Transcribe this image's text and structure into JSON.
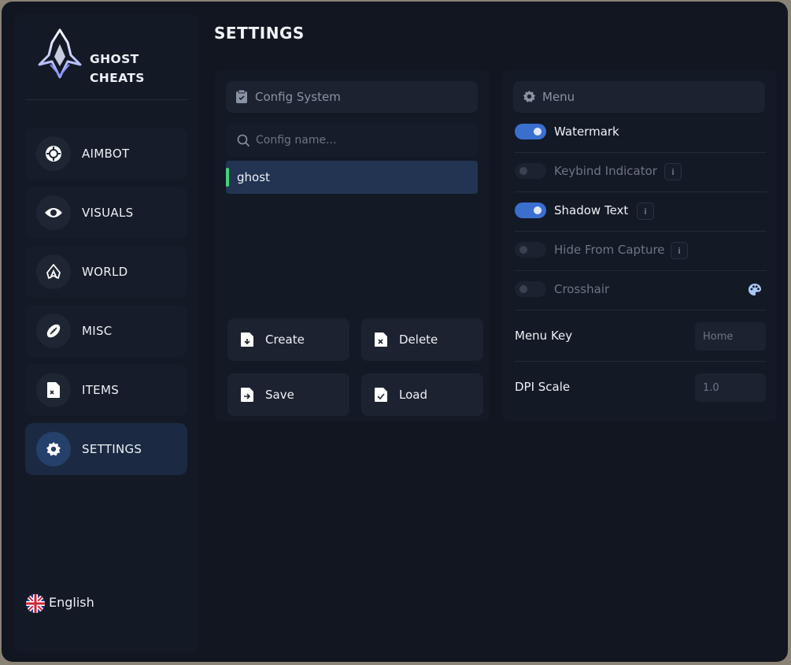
{
  "brand": {
    "name_line1": "GHOST",
    "name_line2": "CHEATS"
  },
  "sidebar": {
    "items": [
      {
        "label": "AIMBOT",
        "icon": "crosshair-icon",
        "active": false
      },
      {
        "label": "VISUALS",
        "icon": "eye-icon",
        "active": false
      },
      {
        "label": "WORLD",
        "icon": "world-icon",
        "active": false
      },
      {
        "label": "MISC",
        "icon": "football-icon",
        "active": false
      },
      {
        "label": "ITEMS",
        "icon": "items-file-icon",
        "active": false
      },
      {
        "label": "SETTINGS",
        "icon": "gear-icon",
        "active": true
      }
    ],
    "language": "English"
  },
  "page": {
    "title": "SETTINGS"
  },
  "config": {
    "header": "Config System",
    "search_placeholder": "Config name...",
    "items": [
      {
        "name": "ghost",
        "selected": true
      }
    ],
    "buttons": {
      "create": "Create",
      "delete": "Delete",
      "save": "Save",
      "load": "Load"
    }
  },
  "menu": {
    "header": "Menu",
    "toggles": [
      {
        "label": "Watermark",
        "on": true,
        "info": false
      },
      {
        "label": "Keybind Indicator",
        "on": false,
        "info": true,
        "info_label": "i"
      },
      {
        "label": "Shadow Text",
        "on": true,
        "info": true,
        "info_label": "i"
      },
      {
        "label": "Hide From Capture",
        "on": false,
        "info": true,
        "info_label": "i"
      },
      {
        "label": "Crosshair",
        "on": false,
        "info": false,
        "color_picker": true
      }
    ],
    "menu_key": {
      "label": "Menu Key",
      "value": "Home"
    },
    "dpi_scale": {
      "label": "DPI Scale",
      "value": "1.0"
    }
  },
  "colors": {
    "accent": "#3a6fd0",
    "selected_bar": "#3ed47a",
    "background": "#111620",
    "panel": "#131925"
  }
}
